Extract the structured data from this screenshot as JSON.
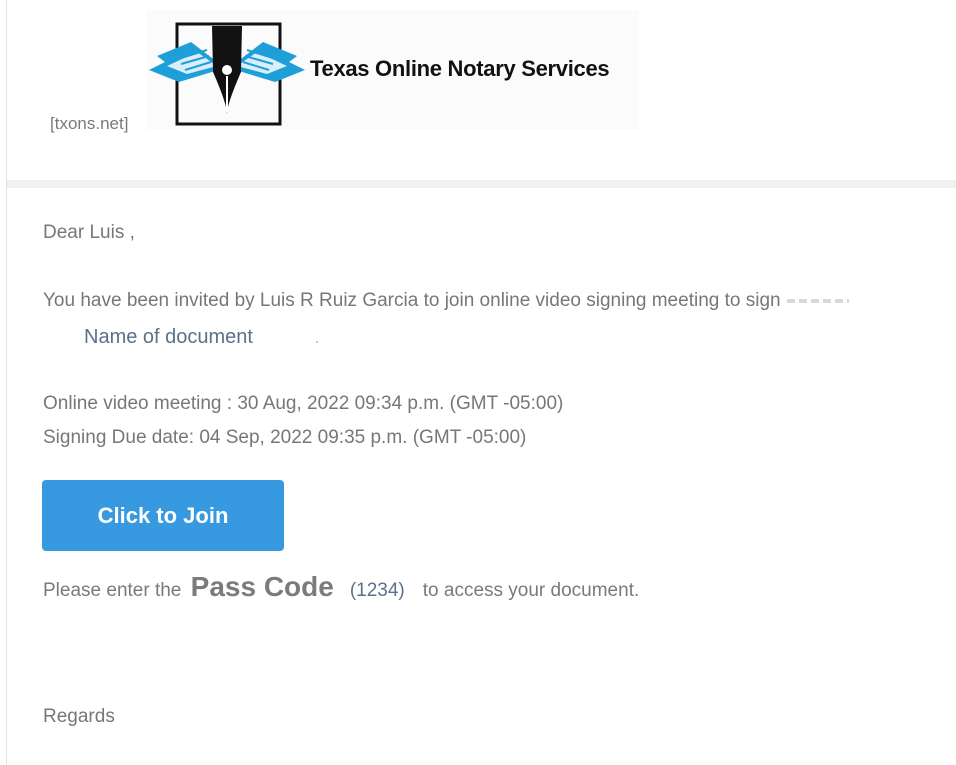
{
  "header": {
    "site_link": "[txons.net]",
    "logo_text": "Texas Online Notary Services"
  },
  "email": {
    "greeting": "Dear Luis ,",
    "invite_text": "You have been invited by Luis R Ruiz Garcia to join online video signing meeting to sign",
    "document_name": "Name of document",
    "meeting_line": "Online video meeting : 30 Aug, 2022 09:34 p.m. (GMT -05:00)",
    "due_line": "Signing Due date: 04 Sep, 2022 09:35 p.m. (GMT -05:00)",
    "join_button_label": "Click to Join",
    "passcode_prefix": "Please enter the",
    "passcode_title": "Pass Code",
    "passcode_value": "(1234)",
    "passcode_suffix": "to access your document.",
    "closing": "Regards"
  },
  "colors": {
    "button": "#3799e0",
    "link_text": "#5b7189",
    "body_text": "#777777",
    "logo_blue": "#1f9fd8"
  },
  "icons": {
    "logo": "pen-nib-book-icon"
  }
}
